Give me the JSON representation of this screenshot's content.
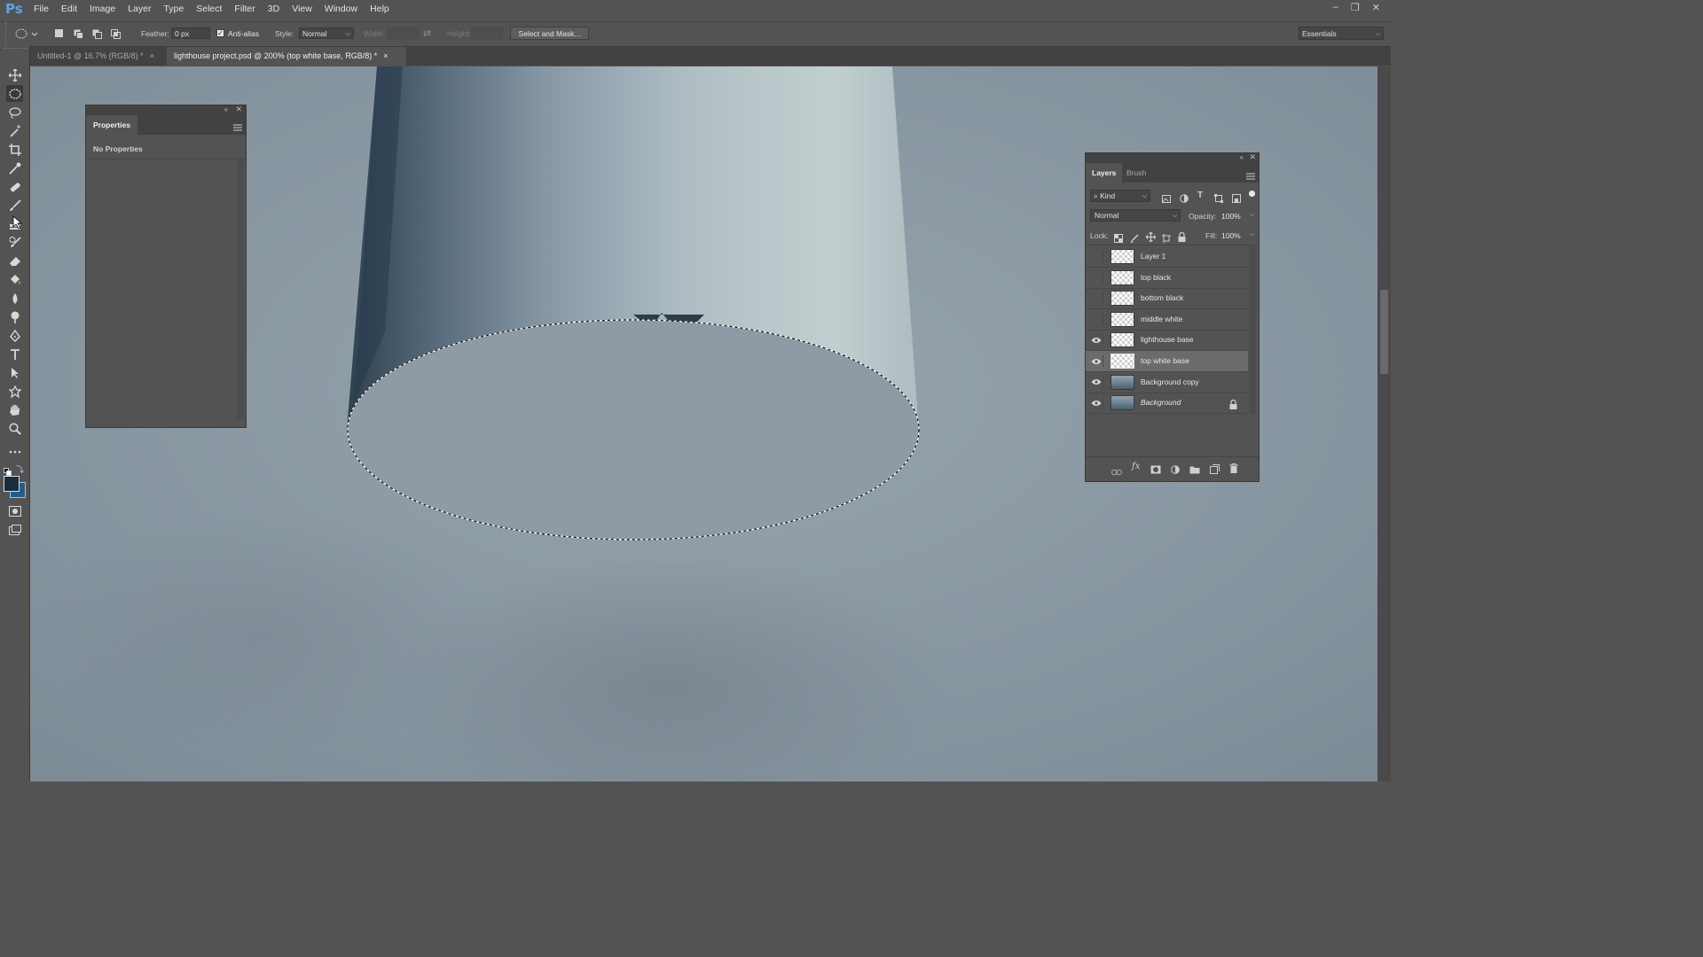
{
  "app": {
    "logo": "Ps"
  },
  "menubar": {
    "items": [
      "File",
      "Edit",
      "Image",
      "Layer",
      "Type",
      "Select",
      "Filter",
      "3D",
      "View",
      "Window",
      "Help"
    ]
  },
  "window_controls": [
    "–",
    "❐",
    "✕"
  ],
  "options": {
    "feather_label": "Feather:",
    "feather_value": "0 px",
    "antialias_label": "Anti-alias",
    "antialias_checked": true,
    "style_label": "Style:",
    "style_value": "Normal",
    "width_label": "Width:",
    "height_label": "Height:",
    "select_mask_label": "Select and Mask...",
    "workspace": "Essentials"
  },
  "tabs": [
    {
      "title": "Untitled-1 @ 16.7% (RGB/8) *",
      "active": false
    },
    {
      "title": "lighthouse project.psd @ 200% (top white base, RGB/8) *",
      "active": true
    }
  ],
  "tab_close": "×",
  "properties_panel": {
    "tab": "Properties",
    "content": "No Properties"
  },
  "layers_panel": {
    "tabs": [
      "Layers",
      "Brush"
    ],
    "filter_kind": "Kind",
    "blend_mode": "Normal",
    "opacity_label": "Opacity:",
    "opacity_value": "100%",
    "lock_label": "Lock:",
    "fill_label": "Fill:",
    "fill_value": "100%",
    "layers": [
      {
        "name": "Layer 1",
        "visible": false,
        "selected": false,
        "thumb": "transparent",
        "locked": false
      },
      {
        "name": "top black",
        "visible": false,
        "selected": false,
        "thumb": "transparent",
        "locked": false
      },
      {
        "name": "bottom black",
        "visible": false,
        "selected": false,
        "thumb": "transparent",
        "locked": false
      },
      {
        "name": "middle white",
        "visible": false,
        "selected": false,
        "thumb": "transparent",
        "locked": false
      },
      {
        "name": "lighthouse base",
        "visible": true,
        "selected": false,
        "thumb": "transparent",
        "locked": false
      },
      {
        "name": "top white base",
        "visible": true,
        "selected": true,
        "thumb": "transparent",
        "locked": false
      },
      {
        "name": "Background copy",
        "visible": true,
        "selected": false,
        "thumb": "photo",
        "locked": false
      },
      {
        "name": "Background",
        "visible": true,
        "selected": false,
        "thumb": "photo",
        "locked": true,
        "italic": true
      }
    ],
    "footer_icons": [
      "link-icon",
      "fx-icon",
      "mask-icon",
      "adjustment-icon",
      "folder-icon",
      "new-layer-icon",
      "trash-icon"
    ]
  },
  "toolbar_tools": [
    "move",
    "elliptical-marquee",
    "lasso",
    "magic-wand",
    "crop",
    "eyedropper",
    "healing-brush",
    "brush",
    "clone-stamp",
    "history-brush",
    "eraser",
    "paint-bucket",
    "blur",
    "dodge",
    "pen",
    "type",
    "path-selection",
    "custom-shape",
    "hand",
    "zoom",
    "more",
    "color-swatches",
    "quick-mask",
    "screen-mode"
  ],
  "colors": {
    "foreground": "#1b2d3a",
    "background": "#1f5e8c",
    "accent": "#5aa4e8"
  }
}
